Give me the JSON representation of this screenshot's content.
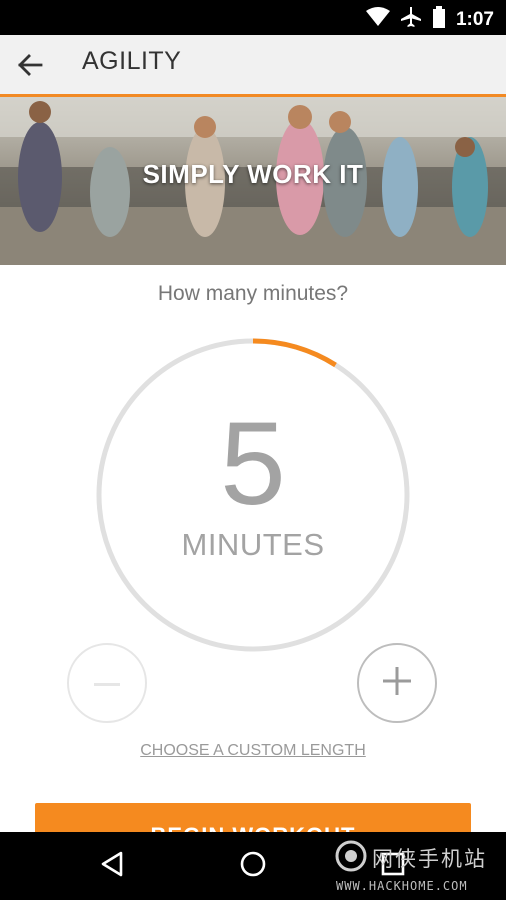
{
  "status_bar": {
    "time": "1:07",
    "icons": [
      "wifi-icon",
      "airplane-icon",
      "battery-icon"
    ]
  },
  "app_bar": {
    "title": "AGILITY",
    "back_icon": "arrow-left-icon"
  },
  "hero": {
    "title": "SIMPLY WORK IT"
  },
  "picker": {
    "question": "How many minutes?",
    "value": "5",
    "unit": "MINUTES",
    "progress_fraction": 0.09,
    "decrement_icon": "minus-icon",
    "increment_icon": "plus-icon",
    "custom_length_link": "CHOOSE A CUSTOM LENGTH"
  },
  "primary_action": {
    "label": "BEGIN WORKOUT"
  },
  "nav_bar": {
    "icons": [
      "back-triangle-icon",
      "home-circle-icon",
      "recents-square-icon"
    ]
  },
  "watermark": {
    "text": "网侠手机站",
    "url": "WWW.HACKHOME.COM"
  },
  "colors": {
    "accent": "#f58a1f",
    "dial_track": "#e0e0e0",
    "text_muted": "#a3a3a3"
  }
}
